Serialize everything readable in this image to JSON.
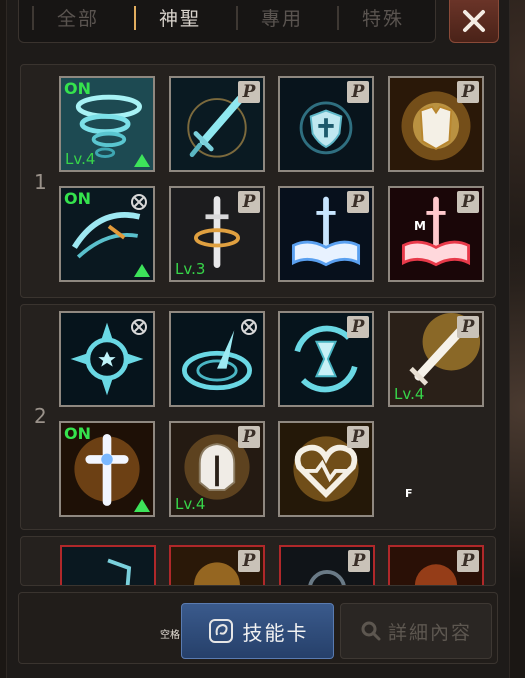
{
  "tabs": [
    {
      "label": "全部",
      "active": false
    },
    {
      "label": "神聖",
      "active": true
    },
    {
      "label": "專用",
      "active": false
    },
    {
      "label": "特殊",
      "active": false
    }
  ],
  "close_icon": "close-icon",
  "groups": [
    {
      "number": "1"
    },
    {
      "number": "2"
    }
  ],
  "skills": {
    "g1r1c1": {
      "icon": "whirlwind-skill-icon",
      "on": "ON",
      "level": "Lv.4",
      "upgrade": true
    },
    "g1r1c2": {
      "icon": "sword-skill-icon",
      "passive": "P"
    },
    "g1r1c3": {
      "icon": "holy-shield-skill-icon",
      "passive": "P"
    },
    "g1r1c4": {
      "icon": "armor-skill-icon",
      "passive": "P"
    },
    "g1r2c1": {
      "icon": "wind-slash-skill-icon",
      "on": "ON",
      "upgrade": true
    },
    "g1r2c2": {
      "icon": "sword-spin-skill-icon",
      "passive": "P",
      "level": "Lv.3"
    },
    "g1r2c3": {
      "icon": "holy-book-skill-icon",
      "passive": "P"
    },
    "g1r2c4": {
      "icon": "red-book-skill-icon",
      "passive": "P",
      "marker": "M"
    },
    "g2r1c1": {
      "icon": "holy-star-skill-icon"
    },
    "g2r1c2": {
      "icon": "sundial-skill-icon"
    },
    "g2r1c3": {
      "icon": "hourglass-skill-icon",
      "passive": "P"
    },
    "g2r1c4": {
      "icon": "sword-burst-skill-icon",
      "passive": "P",
      "level": "Lv.4"
    },
    "g2r2c1": {
      "icon": "holy-cross-skill-icon",
      "on": "ON",
      "upgrade": true
    },
    "g2r2c2": {
      "icon": "helmet-skill-icon",
      "passive": "P",
      "level": "Lv.4"
    },
    "g2r2c3": {
      "icon": "heart-skill-icon",
      "passive": "P"
    }
  },
  "f_label": "F",
  "bottom": {
    "hotkey_label": "空格",
    "skill_card_label": "技能卡",
    "detail_label": "詳細內容"
  },
  "colors": {
    "on_text": "#35e34d",
    "active_tab_marker": "#e2ad5f",
    "primary_button": "#2f4d7c",
    "close_button": "#5a2a20"
  }
}
